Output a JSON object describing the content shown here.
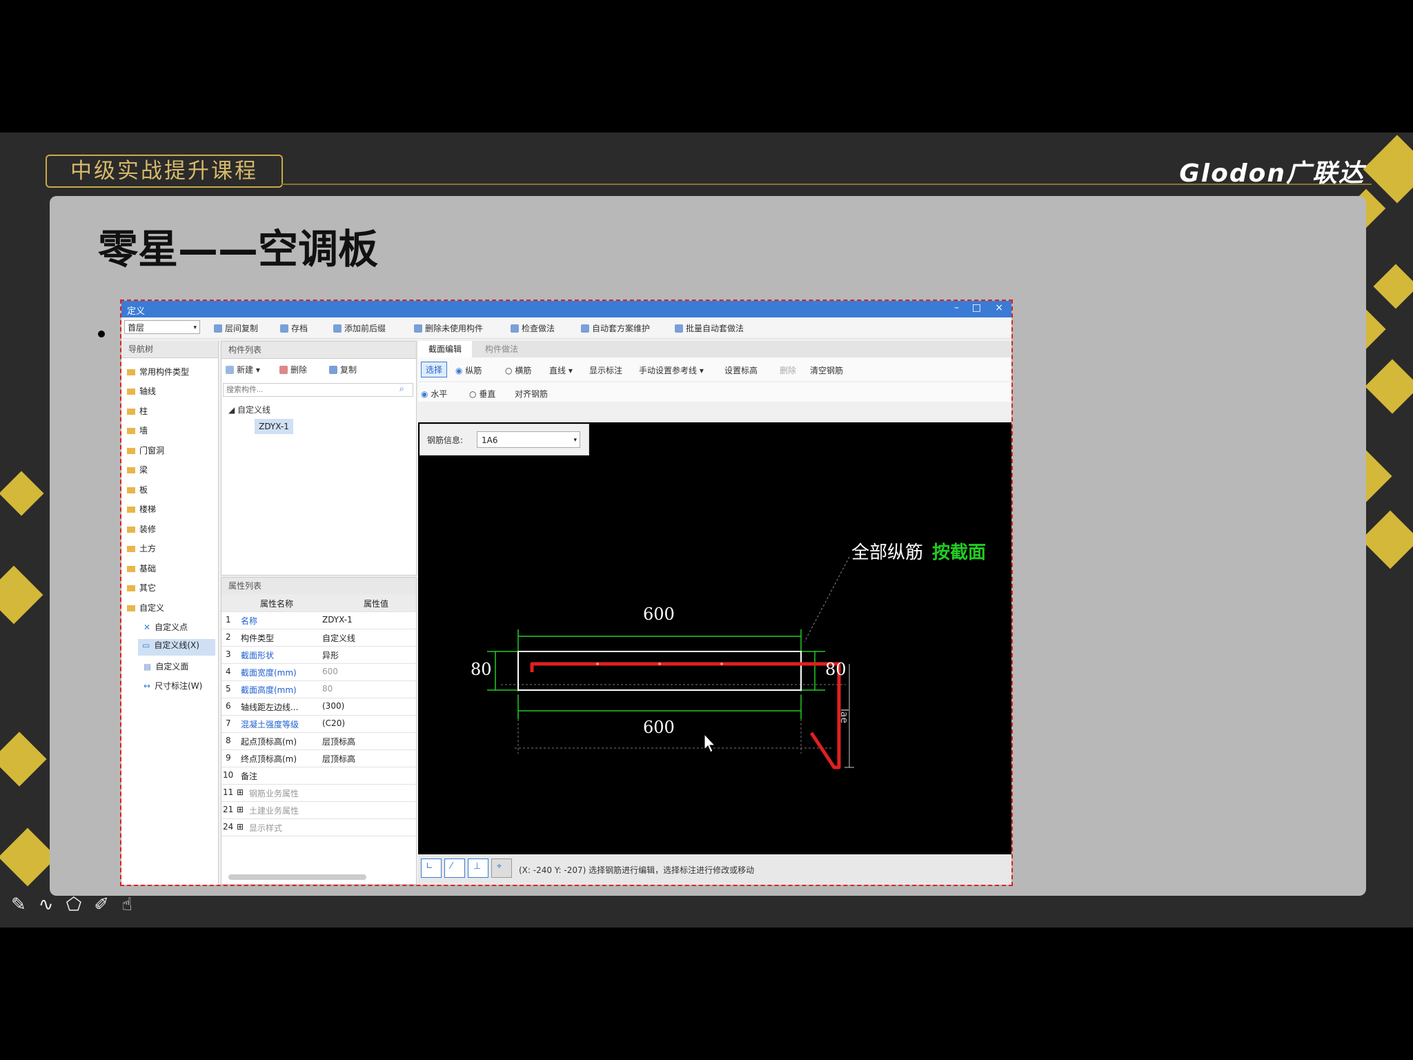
{
  "slide": {
    "course_label": "中级实战提升课程",
    "brand": "Glodon广联达",
    "title": "零星——空调板"
  },
  "window": {
    "title": "定义",
    "controls": [
      "–",
      "□",
      "×"
    ],
    "floor_select": "首层",
    "toolbar": [
      "层间复制",
      "存档",
      "添加前后缀",
      "删除未使用构件",
      "检查做法",
      "自动套方案维护",
      "批量自动套做法"
    ]
  },
  "nav_tree": {
    "header": "导航树",
    "items": [
      "常用构件类型",
      "轴线",
      "柱",
      "墙",
      "门窗洞",
      "梁",
      "板",
      "楼梯",
      "装修",
      "土方",
      "基础",
      "其它",
      "自定义"
    ],
    "sub_items": [
      "自定义点",
      "自定义线(X)",
      "自定义面",
      "尺寸标注(W)"
    ]
  },
  "component_list": {
    "header": "构件列表",
    "actions": [
      "新建",
      "删除",
      "复制"
    ],
    "search_placeholder": "搜索构件...",
    "group": "自定义线",
    "selected": "ZDYX-1"
  },
  "property_list": {
    "header": "属性列表",
    "col_name": "属性名称",
    "col_value": "属性值",
    "rows": [
      {
        "no": "1",
        "name": "名称",
        "value": "ZDYX-1"
      },
      {
        "no": "2",
        "name": "构件类型",
        "value": "自定义线"
      },
      {
        "no": "3",
        "name": "截面形状",
        "value": "异形"
      },
      {
        "no": "4",
        "name": "截面宽度(mm)",
        "value": "600"
      },
      {
        "no": "5",
        "name": "截面高度(mm)",
        "value": "80"
      },
      {
        "no": "6",
        "name": "轴线距左边线...",
        "value": "(300)"
      },
      {
        "no": "7",
        "name": "混凝土强度等级",
        "value": "(C20)"
      },
      {
        "no": "8",
        "name": "起点顶标高(m)",
        "value": "层顶标高"
      },
      {
        "no": "9",
        "name": "终点顶标高(m)",
        "value": "层顶标高"
      },
      {
        "no": "10",
        "name": "备注",
        "value": ""
      },
      {
        "no": "11",
        "name": "钢筋业务属性",
        "value": ""
      },
      {
        "no": "21",
        "name": "土建业务属性",
        "value": ""
      },
      {
        "no": "24",
        "name": "显示样式",
        "value": ""
      }
    ]
  },
  "editor": {
    "tabs": [
      "截面编辑",
      "构件做法"
    ],
    "row1": [
      "选择",
      "纵筋",
      "横筋",
      "直线",
      "显示标注",
      "手动设置参考线",
      "设置标高",
      "删除",
      "清空钢筋"
    ],
    "row2": [
      "水平",
      "垂直",
      "对齐钢筋"
    ],
    "rebar_label": "钢筋信息:",
    "rebar_value": "1A6",
    "annotation_main": "全部纵筋",
    "annotation_sub": "按截面",
    "dim_top": "600",
    "dim_bottom": "600",
    "dim_left": "80",
    "dim_right": "80",
    "dim_vertical": "lae",
    "status": "(X: -240 Y: -207)  选择钢筋进行编辑，选择标注进行修改或移动"
  },
  "colors": {
    "accent_gold": "#d4b83a",
    "window_blue": "#3a7bd5",
    "rebar_red": "#e02020",
    "dim_green": "#22cc22"
  }
}
